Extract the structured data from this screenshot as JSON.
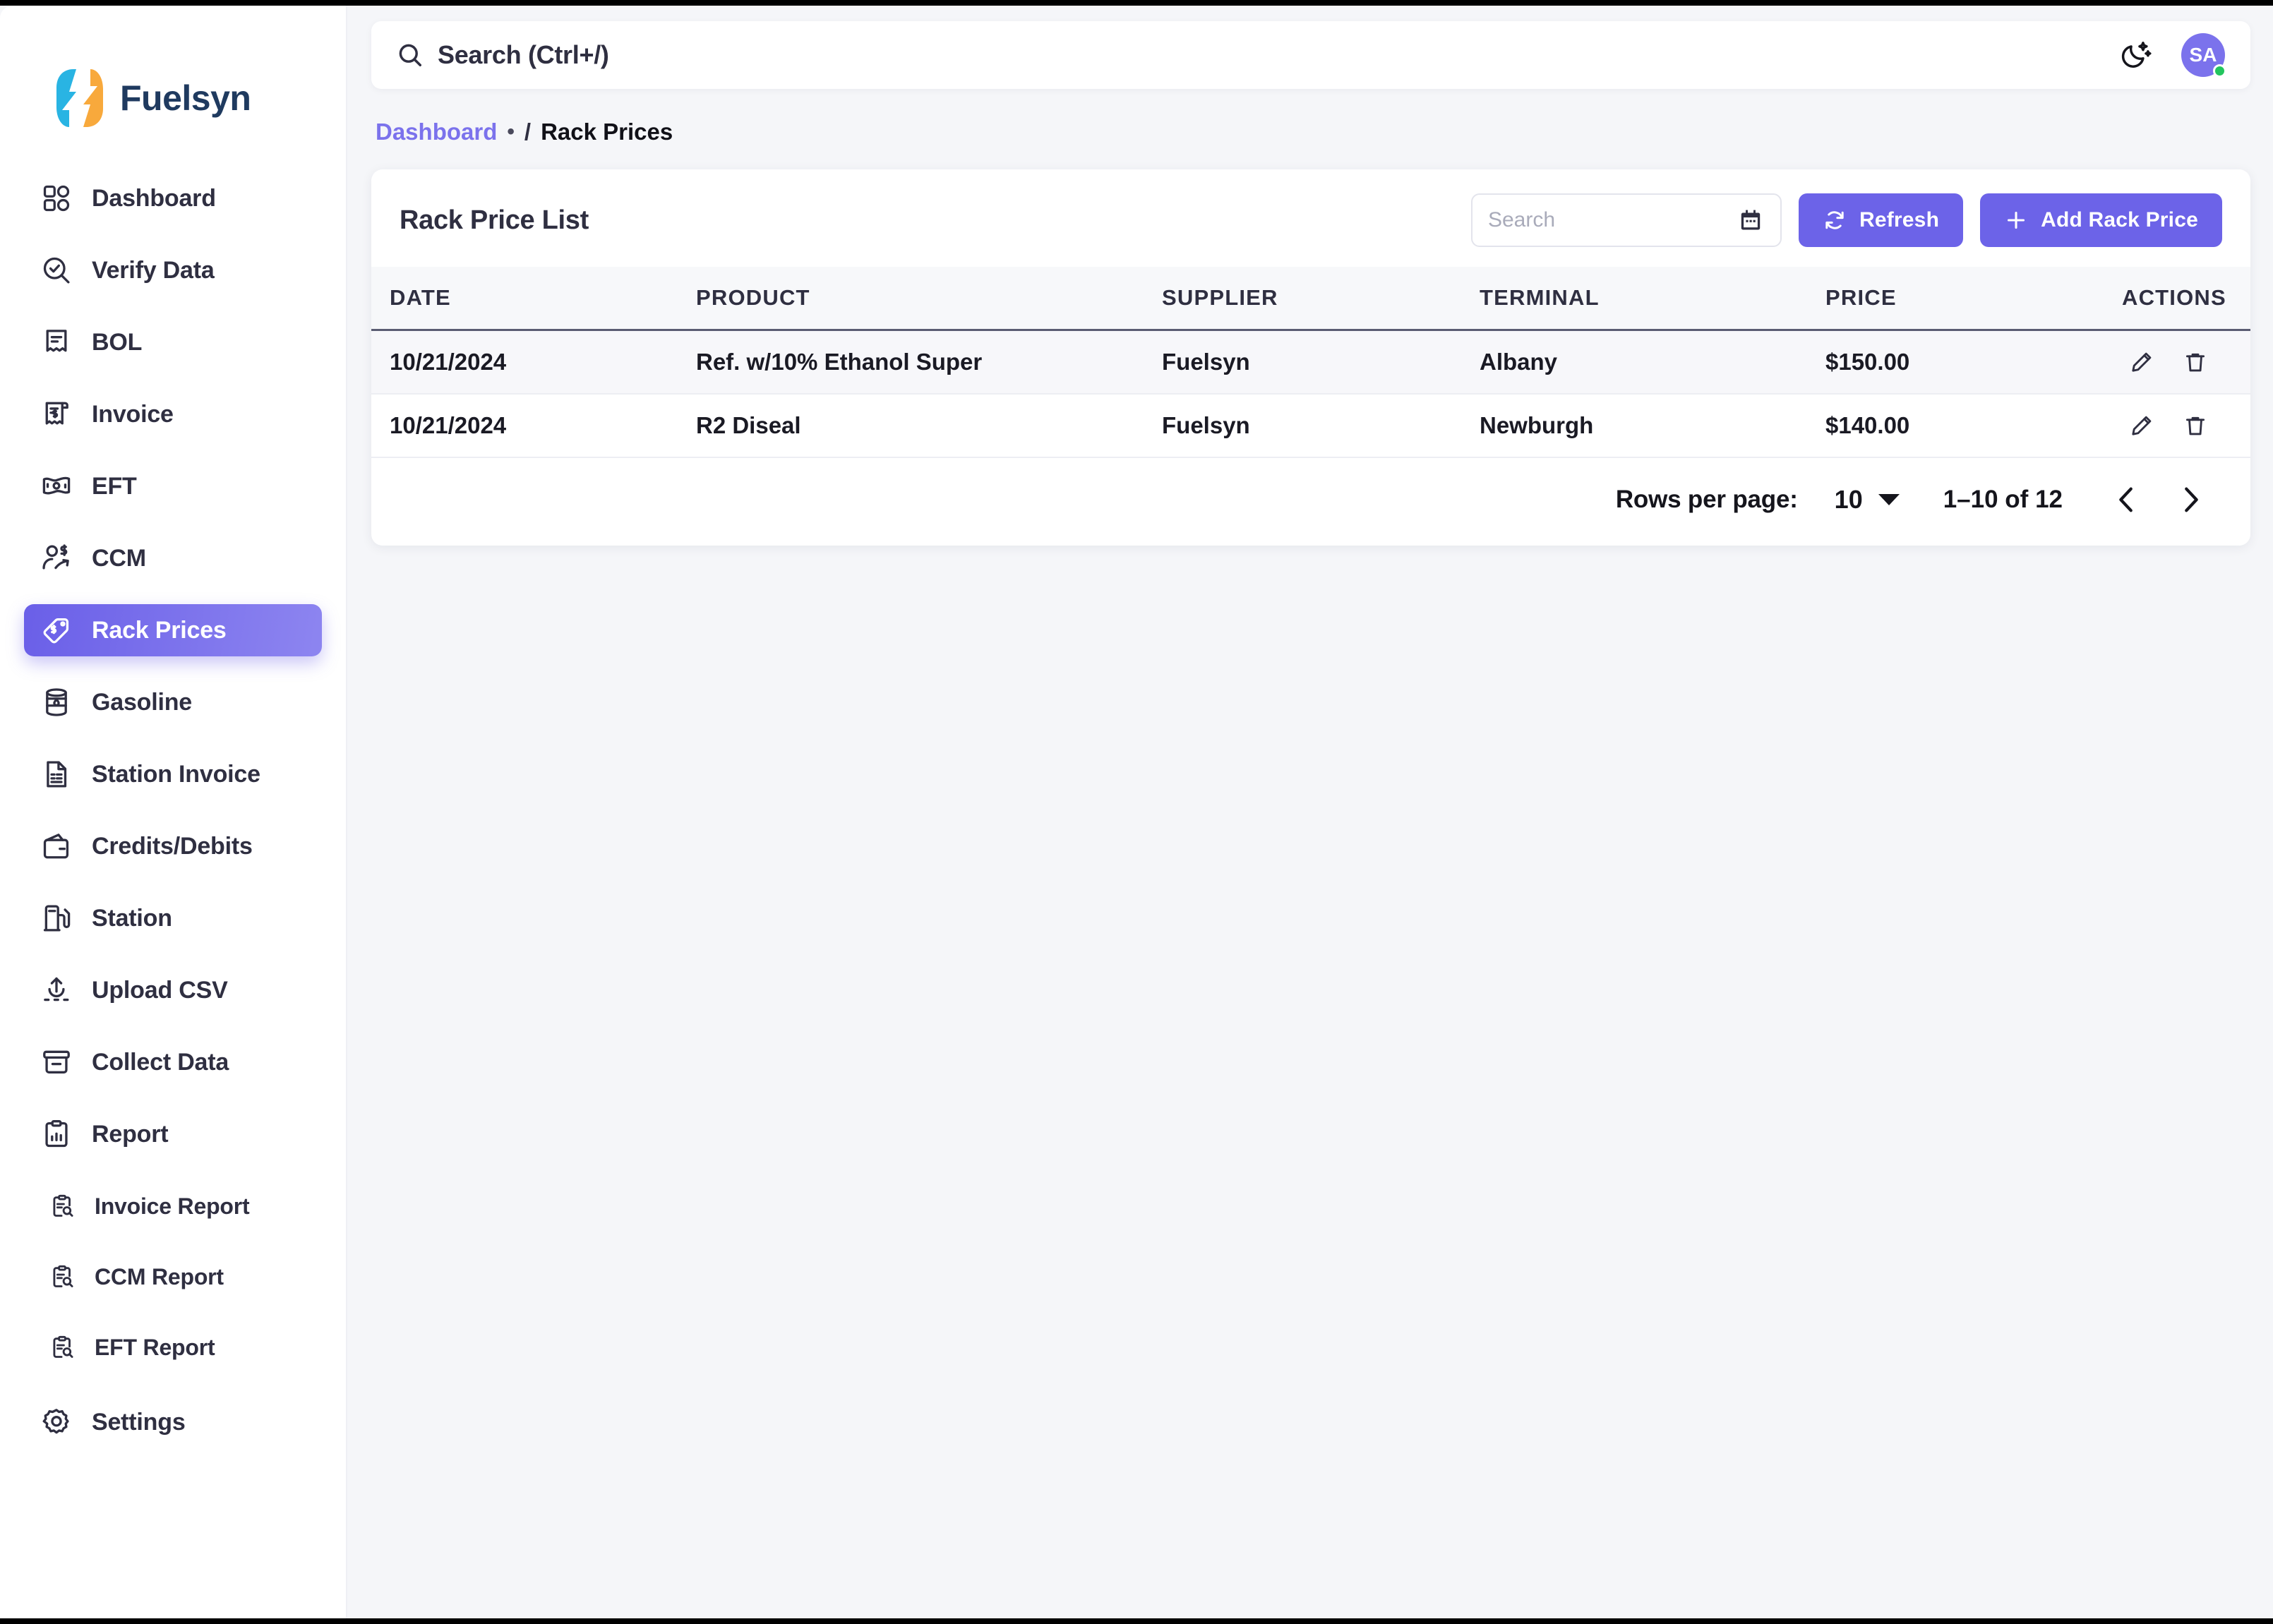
{
  "brand": {
    "name": "Fuelsyn"
  },
  "topbar": {
    "search_placeholder": "Search (Ctrl+/)",
    "search_value": "",
    "theme_icon": "moon-icon",
    "avatar_initials": "SA"
  },
  "breadcrumb": {
    "root": "Dashboard",
    "dot": "•",
    "separator": "/",
    "current": "Rack Prices"
  },
  "sidebar": {
    "items": [
      {
        "label": "Dashboard",
        "icon": "grid-icon",
        "active": false,
        "sub": false
      },
      {
        "label": "Verify Data",
        "icon": "search-check-icon",
        "active": false,
        "sub": false
      },
      {
        "label": "BOL",
        "icon": "receipt-icon",
        "active": false,
        "sub": false
      },
      {
        "label": "Invoice",
        "icon": "invoice-dollar-icon",
        "active": false,
        "sub": false
      },
      {
        "label": "EFT",
        "icon": "banknote-icon",
        "active": false,
        "sub": false
      },
      {
        "label": "CCM",
        "icon": "user-dollar-icon",
        "active": false,
        "sub": false
      },
      {
        "label": "Rack Prices",
        "icon": "price-tag-icon",
        "active": true,
        "sub": false
      },
      {
        "label": "Gasoline",
        "icon": "barrel-icon",
        "active": false,
        "sub": false
      },
      {
        "label": "Station Invoice",
        "icon": "document-icon",
        "active": false,
        "sub": false
      },
      {
        "label": "Credits/Debits",
        "icon": "wallet-icon",
        "active": false,
        "sub": false
      },
      {
        "label": "Station",
        "icon": "fuel-pump-icon",
        "active": false,
        "sub": false
      },
      {
        "label": "Upload CSV",
        "icon": "upload-icon",
        "active": false,
        "sub": false
      },
      {
        "label": "Collect Data",
        "icon": "archive-icon",
        "active": false,
        "sub": false
      },
      {
        "label": "Report",
        "icon": "clipboard-chart-icon",
        "active": false,
        "sub": false
      },
      {
        "label": "Invoice Report",
        "icon": "clipboard-search-icon",
        "active": false,
        "sub": true
      },
      {
        "label": "CCM Report",
        "icon": "clipboard-search-icon",
        "active": false,
        "sub": true
      },
      {
        "label": "EFT Report",
        "icon": "clipboard-search-icon",
        "active": false,
        "sub": true
      },
      {
        "label": "Settings",
        "icon": "gear-icon",
        "active": false,
        "sub": false
      }
    ]
  },
  "card": {
    "title": "Rack Price List",
    "search_placeholder": "Search",
    "search_value": "",
    "search_icon": "calendar-icon",
    "refresh_label": "Refresh",
    "refresh_icon": "refresh-icon",
    "add_label": "Add Rack Price",
    "add_icon": "plus-icon"
  },
  "table": {
    "columns": [
      "DATE",
      "PRODUCT",
      "SUPPLIER",
      "TERMINAL",
      "PRICE",
      "ACTIONS"
    ],
    "rows": [
      {
        "date": "10/21/2024",
        "product": "Ref. w/10% Ethanol Super",
        "supplier": "Fuelsyn",
        "terminal": "Albany",
        "price": "$150.00",
        "edit_icon": "pencil-icon",
        "delete_icon": "trash-icon"
      },
      {
        "date": "10/21/2024",
        "product": "R2 Diseal",
        "supplier": "Fuelsyn",
        "terminal": "Newburgh",
        "price": "$140.00",
        "edit_icon": "pencil-icon",
        "delete_icon": "trash-icon"
      }
    ]
  },
  "pagination": {
    "rows_per_page_label": "Rows per page:",
    "rows_per_page_value": "10",
    "range": "1–10 of 12",
    "prev_icon": "chevron-left-icon",
    "next_icon": "chevron-right-icon"
  },
  "colors": {
    "accent": "#6C63E8",
    "accent_light": "#8D85F0",
    "brand_text": "#1F3A5F",
    "logo_blue": "#29B4E3",
    "logo_orange": "#F8A93C",
    "status_online": "#23C55E",
    "page_bg": "#F5F6F9"
  }
}
